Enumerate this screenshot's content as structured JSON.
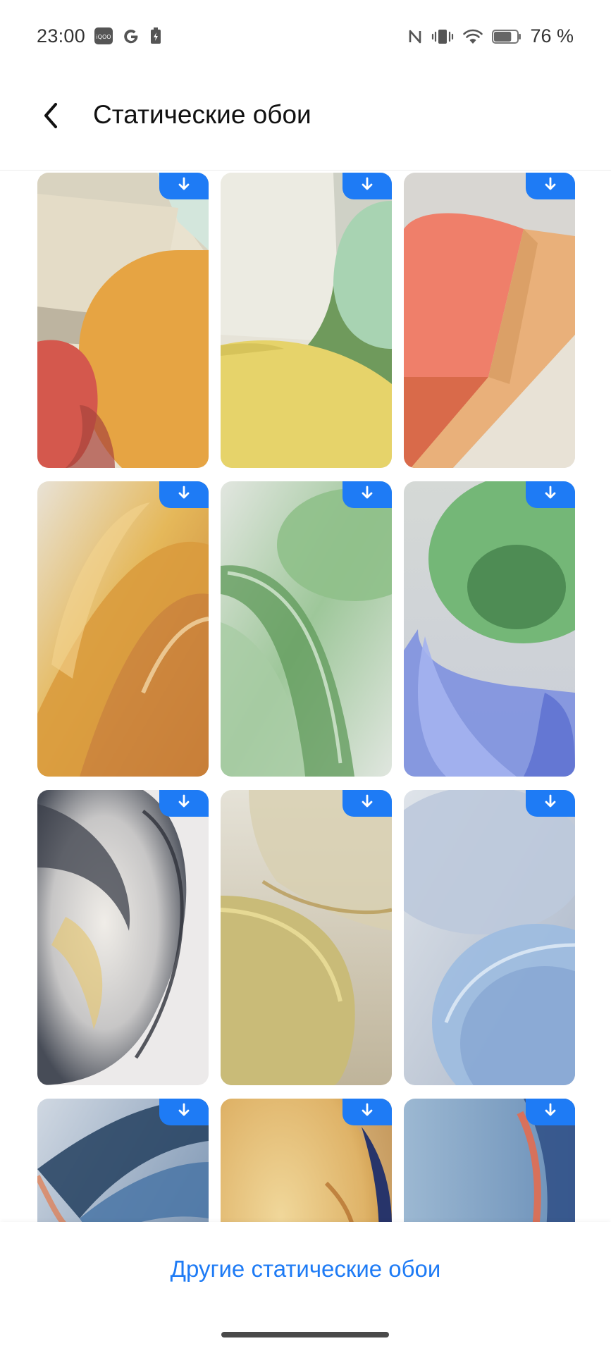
{
  "status_bar": {
    "time": "23:00",
    "left_icons": [
      "iqoo-badge-icon",
      "google-icon",
      "battery-saver-icon"
    ],
    "right_icons": [
      "nfc-icon",
      "vibrate-icon",
      "wifi-icon",
      "battery-icon"
    ],
    "battery_text": "76 %",
    "battery_level": 0.76
  },
  "header": {
    "title": "Статические обои",
    "back_icon": "chevron-left-icon"
  },
  "wallpapers": {
    "download_icon": "download-arrow-icon",
    "accent_color": "#1e7bf5",
    "items": [
      {
        "theme": "orange-red-blocks"
      },
      {
        "theme": "green-yellow-blocks"
      },
      {
        "theme": "coral-wood-blocks"
      },
      {
        "theme": "amber-glass-waves"
      },
      {
        "theme": "green-glass-waves"
      },
      {
        "theme": "green-blue-glass"
      },
      {
        "theme": "silver-glass-orb"
      },
      {
        "theme": "yellow-glass-orb"
      },
      {
        "theme": "blue-glass-orb"
      },
      {
        "theme": "blue-dark-waves"
      },
      {
        "theme": "gold-navy-orb"
      },
      {
        "theme": "blue-coral-waves"
      }
    ]
  },
  "footer": {
    "more_link": "Другие статические обои"
  }
}
